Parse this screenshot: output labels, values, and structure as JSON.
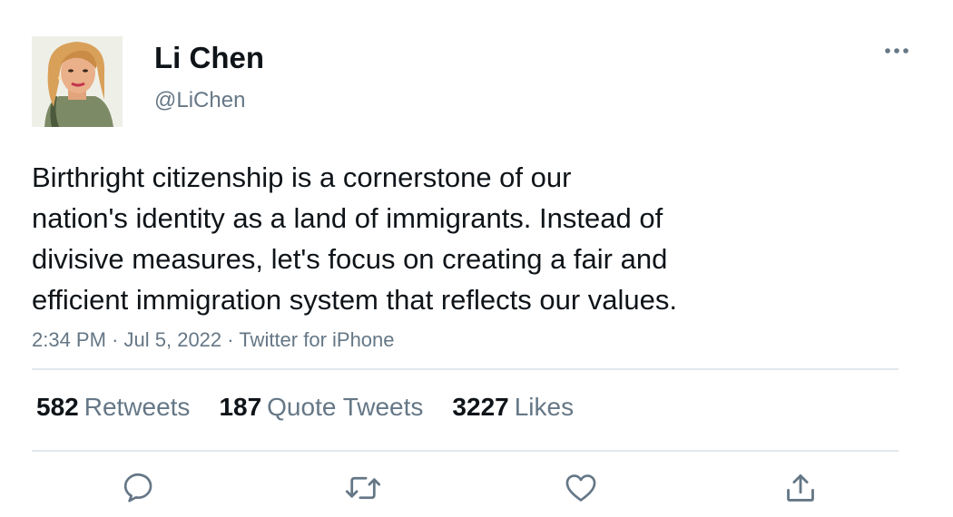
{
  "author": {
    "display_name": "Li Chen",
    "handle": "@LiChen"
  },
  "tweet": {
    "text_lines": [
      "Birthright citizenship is a cornerstone of our",
      "nation's identity as a land of immigrants. Instead of",
      "divisive measures, let's focus on creating a fair and",
      "efficient immigration system that reflects our values."
    ],
    "time": "2:34 PM",
    "separator": "·",
    "date": "Jul 5, 2022",
    "source": "Twitter for iPhone"
  },
  "stats": {
    "retweets": {
      "count": "582",
      "label": "Retweets"
    },
    "quote_tweets": {
      "count": "187",
      "label": "Quote Tweets"
    },
    "likes": {
      "count": "3227",
      "label": "Likes"
    }
  },
  "icons": {
    "more": "more-horizontal-icon",
    "reply": "reply-bubble-icon",
    "retweet": "retweet-icon",
    "like": "heart-icon",
    "share": "share-upload-icon"
  },
  "colors": {
    "text_primary": "#0f1419",
    "text_secondary": "#657786",
    "divider": "#e1e8ed"
  }
}
